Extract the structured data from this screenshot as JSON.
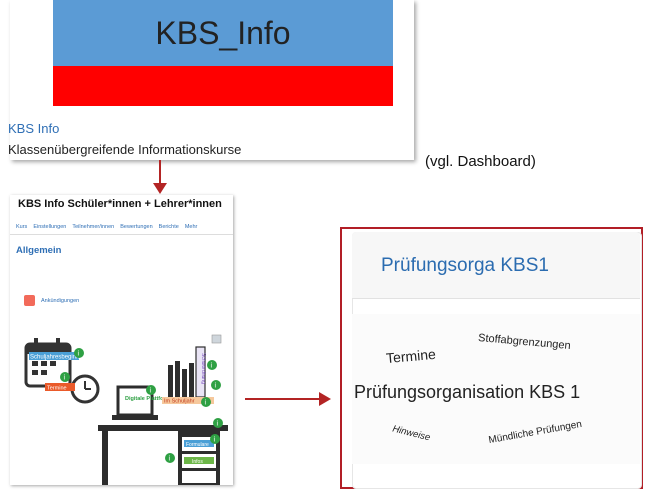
{
  "course_card": {
    "banner_text": "KBS_Info",
    "banner_colors": {
      "top": "#5b9bd5",
      "bottom": "#ff0000"
    },
    "link": "KBS Info",
    "description": "Klassenübergreifende Informationskurse"
  },
  "note": "(vgl. Dashboard)",
  "course_page": {
    "title": "KBS Info Schüler*innen + Lehrer*innen",
    "tabs": [
      "Kurs",
      "Einstellungen",
      "Teilnehmer/innen",
      "Bewertungen",
      "Berichte",
      "Mehr"
    ],
    "section": "Allgemein",
    "announcements": "Ankündigungen",
    "illustration_labels": {
      "calendar": "Schuljahresbeginn",
      "calendar_tag": "Termine",
      "laptop": "Digitale Plattformen",
      "shelf": "Im Schuljahr",
      "binder": "Schulordnung",
      "drawer1": "Formulare",
      "drawer2": "Infos"
    }
  },
  "orga_card": {
    "title": "Prüfungsorga KBS1",
    "cloud": {
      "center": "Prüfungsorganisation KBS 1",
      "termine": "Termine",
      "stoff": "Stoffabgrenzungen",
      "hinweise": "Hinweise",
      "muendlich": "Mündliche Prüfungen"
    }
  },
  "colors": {
    "accent_red": "#b21e26",
    "link_blue": "#2f6fb5"
  }
}
